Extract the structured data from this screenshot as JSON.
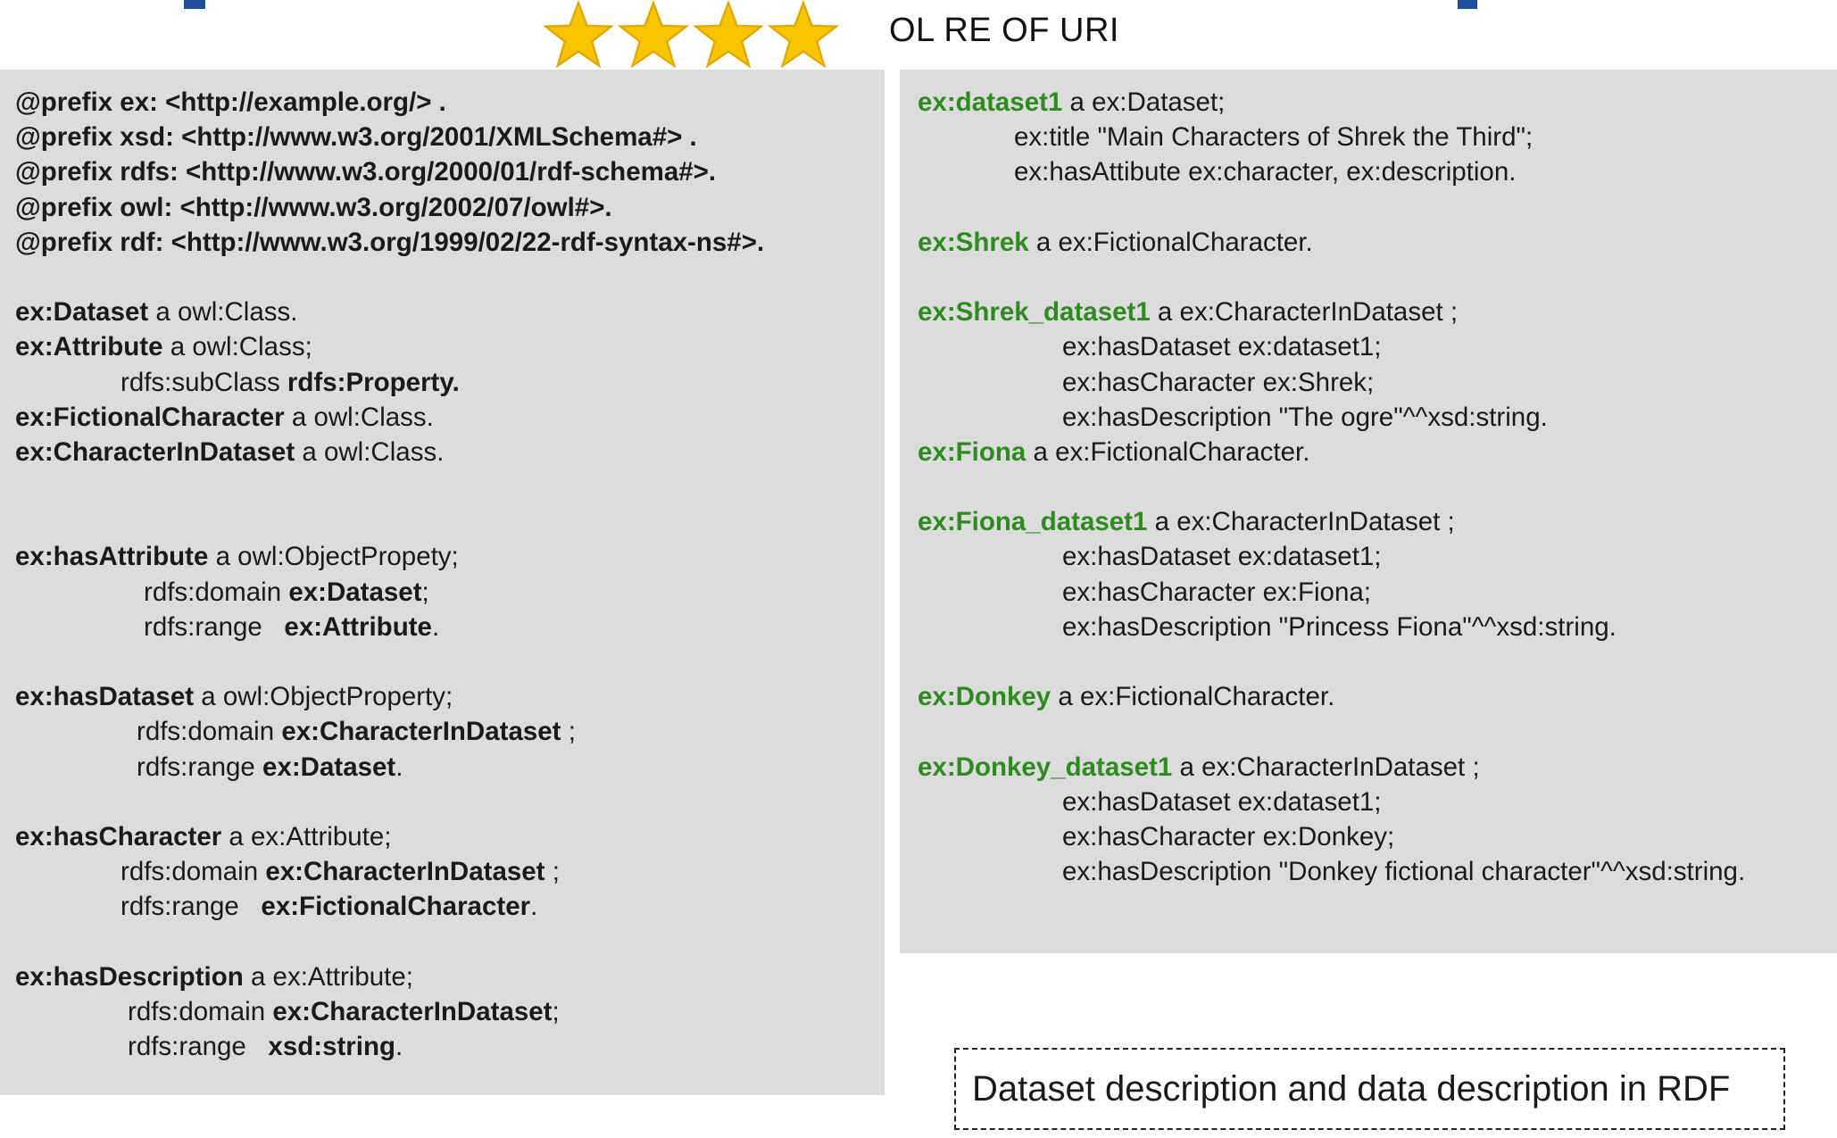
{
  "header": {
    "stars": 4,
    "star_color": "#f7c600",
    "brand_blue": "#1f4e9c",
    "text": "OL RE OF URI"
  },
  "ontology": {
    "prefixes": [
      "@prefix ex: <http://example.org/> .",
      "@prefix xsd: <http://www.w3.org/2001/XMLSchema#> .",
      "@prefix rdfs: <http://www.w3.org/2000/01/rdf-schema#>.",
      "@prefix owl: <http://www.w3.org/2002/07/owl#>.",
      "@prefix rdf: <http://www.w3.org/1999/02/22-rdf-syntax-ns#>."
    ],
    "dataset_class": {
      "subject": "ex:Dataset",
      "rest": " a owl:Class."
    },
    "attribute_class": {
      "subject": "ex:Attribute",
      "rest": " a owl:Class;",
      "sub_pred": "rdfs:subClass ",
      "sub_obj": "rdfs:Property."
    },
    "fictional_class": {
      "subject": "ex:FictionalCharacter",
      "rest": " a owl:Class."
    },
    "cid_class": {
      "subject": "ex:CharacterInDataset",
      "rest": " a owl:Class."
    },
    "has_attribute": {
      "subject": "ex:hasAttribute",
      "rest": " a owl:ObjectPropety;",
      "domain_pred": "rdfs:domain ",
      "domain_obj": "ex:Dataset",
      "domain_end": ";",
      "range_pred": "rdfs:range   ",
      "range_obj": "ex:Attribute",
      "range_end": "."
    },
    "has_dataset": {
      "subject": "ex:hasDataset",
      "rest": " a owl:ObjectProperty;",
      "domain_pred": "rdfs:domain ",
      "domain_obj": "ex:CharacterInDataset",
      "domain_end": " ;",
      "range_pred": "rdfs:range ",
      "range_obj": "ex:Dataset",
      "range_end": "."
    },
    "has_character": {
      "subject": "ex:hasCharacter",
      "rest": " a ex:Attribute;",
      "domain_pred": "rdfs:domain ",
      "domain_obj": "ex:CharacterInDataset",
      "domain_end": " ;",
      "range_pred": "rdfs:range   ",
      "range_obj": "ex:FictionalCharacter",
      "range_end": "."
    },
    "has_description": {
      "subject": "ex:hasDescription",
      "rest": " a ex:Attribute;",
      "domain_pred": "rdfs:domain ",
      "domain_obj": "ex:CharacterInDataset",
      "domain_end": ";",
      "range_pred": "rdfs:range   ",
      "range_obj": "xsd:string",
      "range_end": "."
    }
  },
  "data": {
    "dataset1": {
      "subject": "ex:dataset1",
      "rest": " a ex:Dataset;",
      "title_line": "ex:title \"Main Characters of Shrek the Third\";",
      "attr_line": "ex:hasAttibute ex:character, ex:description."
    },
    "shrek": {
      "subject": "ex:Shrek",
      "rest": " a ex:FictionalCharacter."
    },
    "shrek_ds": {
      "subject": "ex:Shrek_dataset1",
      "rest": " a ex:CharacterInDataset ;",
      "lines": [
        "ex:hasDataset ex:dataset1;",
        "ex:hasCharacter ex:Shrek;",
        "ex:hasDescription \"The ogre\"^^xsd:string."
      ]
    },
    "fiona": {
      "subject": "ex:Fiona",
      "rest": " a ex:FictionalCharacter."
    },
    "fiona_ds": {
      "subject": "ex:Fiona_dataset1",
      "rest": " a ex:CharacterInDataset ;",
      "lines": [
        "ex:hasDataset ex:dataset1;",
        "ex:hasCharacter ex:Fiona;",
        "ex:hasDescription \"Princess Fiona\"^^xsd:string."
      ]
    },
    "donkey": {
      "subject": "ex:Donkey",
      "rest": " a ex:FictionalCharacter."
    },
    "donkey_ds": {
      "subject": "ex:Donkey_dataset1",
      "rest": " a ex:CharacterInDataset ;",
      "lines": [
        "ex:hasDataset ex:dataset1;",
        "ex:hasCharacter ex:Donkey;",
        "ex:hasDescription \"Donkey fictional character\"^^xsd:string."
      ]
    }
  },
  "caption": "Dataset description and data description in RDF",
  "colors": {
    "panel_bg": "#dcdcdc",
    "subject_green": "#2e8b1f"
  }
}
